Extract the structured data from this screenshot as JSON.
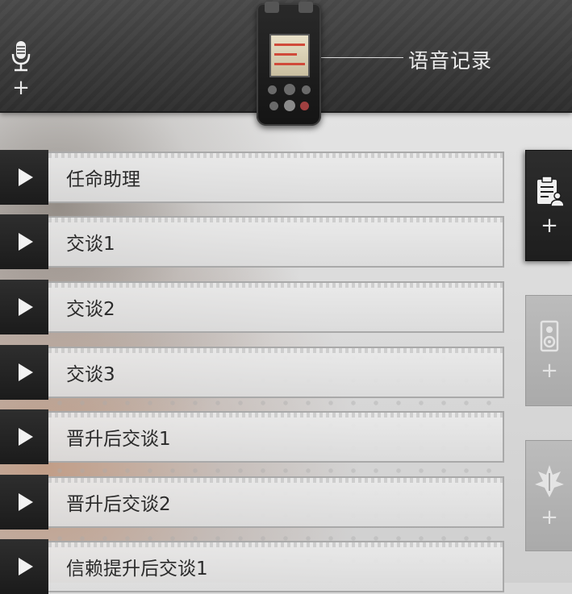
{
  "header": {
    "title": "语音记录",
    "left_tab": {
      "icon": "microphone-icon",
      "plus": "+"
    },
    "recorder_image": "voice-recorder-device"
  },
  "voice_lines": [
    {
      "label": "任命助理",
      "icon": "play-icon"
    },
    {
      "label": "交谈1",
      "icon": "play-icon"
    },
    {
      "label": "交谈2",
      "icon": "play-icon"
    },
    {
      "label": "交谈3",
      "icon": "play-icon"
    },
    {
      "label": "晋升后交谈1",
      "icon": "play-icon"
    },
    {
      "label": "晋升后交谈2",
      "icon": "play-icon"
    },
    {
      "label": "信赖提升后交谈1",
      "icon": "play-icon"
    }
  ],
  "side_tabs": [
    {
      "icon": "clipboard-person-icon",
      "plus": "+",
      "state": "active"
    },
    {
      "icon": "speaker-icon",
      "plus": "+",
      "state": "inactive"
    },
    {
      "icon": "faction-emblem-icon",
      "plus": "+",
      "state": "inactive"
    }
  ],
  "colors": {
    "header_bg": "#3a3a3a",
    "play_button_bg": "#1f1f1f",
    "row_bg": "#e4e4e4",
    "accent_red": "#d04a3a"
  }
}
